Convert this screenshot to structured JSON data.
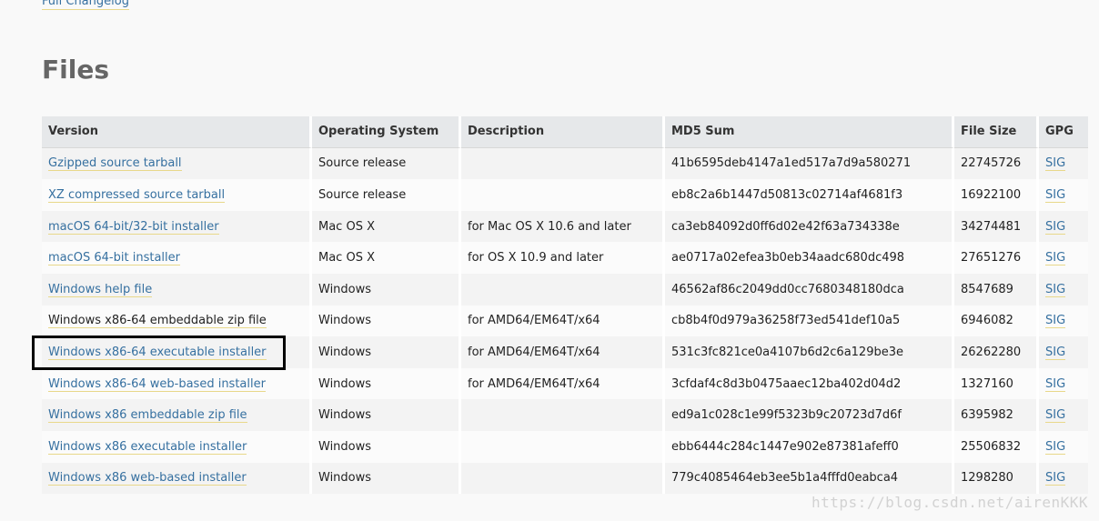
{
  "page": {
    "changelog_link": "Full Changelog",
    "section_title": "Files",
    "watermark": "https://blog.csdn.net/airenKKK"
  },
  "table": {
    "headers": {
      "version": "Version",
      "os": "Operating System",
      "description": "Description",
      "md5": "MD5 Sum",
      "size": "File Size",
      "gpg": "GPG"
    },
    "rows": [
      {
        "version": "Gzipped source tarball",
        "os": "Source release",
        "description": "",
        "md5": "41b6595deb4147a1ed517a7d9a580271",
        "size": "22745726",
        "gpg": "SIG"
      },
      {
        "version": "XZ compressed source tarball",
        "os": "Source release",
        "description": "",
        "md5": "eb8c2a6b1447d50813c02714af4681f3",
        "size": "16922100",
        "gpg": "SIG"
      },
      {
        "version": "macOS 64-bit/32-bit installer",
        "os": "Mac OS X",
        "description": "for Mac OS X 10.6 and later",
        "md5": "ca3eb84092d0ff6d02e42f63a734338e",
        "size": "34274481",
        "gpg": "SIG"
      },
      {
        "version": "macOS 64-bit installer",
        "os": "Mac OS X",
        "description": "for OS X 10.9 and later",
        "md5": "ae0717a02efea3b0eb34aadc680dc498",
        "size": "27651276",
        "gpg": "SIG"
      },
      {
        "version": "Windows help file",
        "os": "Windows",
        "description": "",
        "md5": "46562af86c2049dd0cc7680348180dca",
        "size": "8547689",
        "gpg": "SIG"
      },
      {
        "version": "Windows x86-64 embeddable zip file",
        "os": "Windows",
        "description": "for AMD64/EM64T/x64",
        "md5": "cb8b4f0d979a36258f73ed541def10a5",
        "size": "6946082",
        "gpg": "SIG"
      },
      {
        "version": "Windows x86-64 executable installer",
        "os": "Windows",
        "description": "for AMD64/EM64T/x64",
        "md5": "531c3fc821ce0a4107b6d2c6a129be3e",
        "size": "26262280",
        "gpg": "SIG"
      },
      {
        "version": "Windows x86-64 web-based installer",
        "os": "Windows",
        "description": "for AMD64/EM64T/x64",
        "md5": "3cfdaf4c8d3b0475aaec12ba402d04d2",
        "size": "1327160",
        "gpg": "SIG"
      },
      {
        "version": "Windows x86 embeddable zip file",
        "os": "Windows",
        "description": "",
        "md5": "ed9a1c028c1e99f5323b9c20723d7d6f",
        "size": "6395982",
        "gpg": "SIG"
      },
      {
        "version": "Windows x86 executable installer",
        "os": "Windows",
        "description": "",
        "md5": "ebb6444c284c1447e902e87381afeff0",
        "size": "25506832",
        "gpg": "SIG"
      },
      {
        "version": "Windows x86 web-based installer",
        "os": "Windows",
        "description": "",
        "md5": "779c4085464eb3ee5b1a4fffd0eabca4",
        "size": "1298280",
        "gpg": "SIG"
      }
    ]
  }
}
